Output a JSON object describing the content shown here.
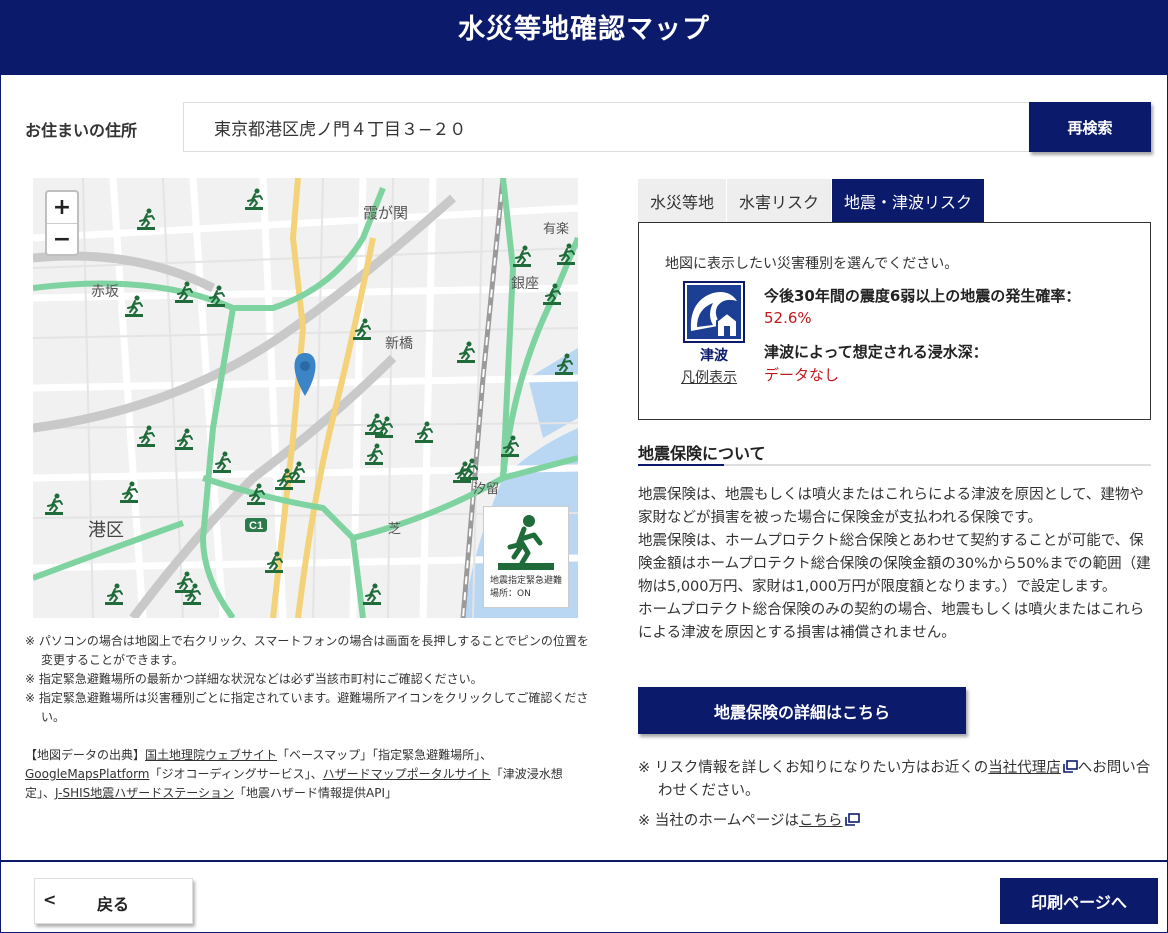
{
  "header": {
    "title": "水災等地確認マップ"
  },
  "address": {
    "label": "お住まいの住所",
    "value": "東京都港区虎ノ門４丁目３−２０",
    "search_button": "再検索"
  },
  "map": {
    "zoom_in": "+",
    "zoom_out": "−",
    "place_labels": [
      "霞が関",
      "赤坂",
      "新橋",
      "銀座",
      "港区",
      "芝",
      "有楽",
      "汐留"
    ],
    "road_label": "C1",
    "legend_text_1": "地震指定緊急避難",
    "legend_text_2": "場所：ON"
  },
  "map_notes": [
    "※ パソコンの場合は地図上で右クリック、スマートフォンの場合は画面を長押しすることでピンの位置を変更することができます。",
    "※ 指定緊急避難場所の最新かつ詳細な状況などは必ず当該市町村にご確認ください。",
    "※ 指定緊急避難場所は災害種別ごとに指定されています。避難場所アイコンをクリックしてご確認ください。"
  ],
  "source": {
    "prefix": "【地図データの出典】",
    "link1": "国土地理院ウェブサイト",
    "text1": "「ベースマップ」「指定緊急避難場所」、",
    "link2": "GoogleMapsPlatform",
    "text2": "「ジオコーディングサービス」、",
    "link3": "ハザードマップポータルサイト",
    "text3": "「津波浸水想定」、",
    "link4": "J-SHIS地震ハザードステーション",
    "text4": "「地震ハザード情報提供API」"
  },
  "tabs": [
    {
      "label": "水災等地",
      "active": false
    },
    {
      "label": "水害リスク",
      "active": false
    },
    {
      "label": "地震・津波リスク",
      "active": true
    }
  ],
  "risk": {
    "intro": "地図に表示したい災害種別を選んでください。",
    "icon_label": "津波",
    "legend_link": "凡例表示",
    "q1": "今後30年間の震度6弱以上の地震の発生確率：",
    "v1": "52.6%",
    "q2": "津波によって想定される浸水深：",
    "v2": "データなし"
  },
  "insurance": {
    "heading": "地震保険について",
    "p1": "地震保険は、地震もしくは噴火またはこれらによる津波を原因として、建物や家財などが損害を被った場合に保険金が支払われる保険です。",
    "p2": "地震保険は、ホームプロテクト総合保険とあわせて契約することが可能で、保険金額はホームプロテクト総合保険の保険金額の30%から50%までの範囲（建物は5,000万円、家財は1,000万円が限度額となります。）で設定します。",
    "p3": " ホームプロテクト総合保険のみの契約の場合、地震もしくは噴火またはこれらによる津波を原因とする損害は補償されません。",
    "detail_button": "地震保険の詳細はこちら"
  },
  "footnotes": {
    "n1_prefix": "※ リスク情報を詳しくお知りになりたい方はお近くの",
    "n1_link": "当社代理店",
    "n1_suffix": "へお問い合わせください。",
    "n2_prefix": "※ 当社のホームページは",
    "n2_link": "こちら"
  },
  "footer": {
    "back_chevron": "<",
    "back_button": "戻る",
    "print_button": "印刷ページへ"
  },
  "colors": {
    "brand": "#0b1a6b",
    "alert": "#c0191e",
    "park": "#7fd3a0",
    "shelter": "#1f6b3a"
  }
}
